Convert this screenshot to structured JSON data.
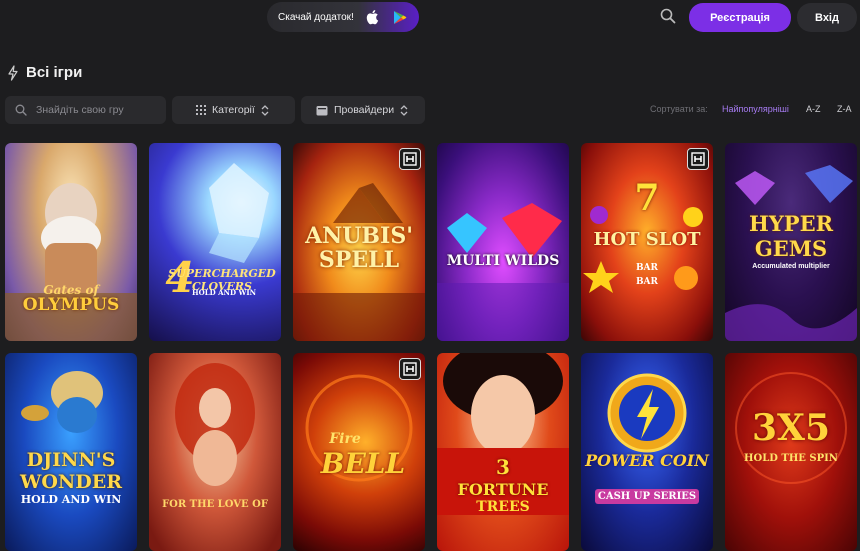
{
  "header": {
    "app_download_label": "Скачай додаток!",
    "register_label": "Реєстрація",
    "login_label": "Вхід"
  },
  "section": {
    "title": "Всі ігри"
  },
  "filters": {
    "search_placeholder": "Знайдіть свою гру",
    "categories_label": "Категорії",
    "providers_label": "Провайдери",
    "sort_label": "Сортувати за:",
    "sort_options": [
      "Найпопулярніші",
      "A-Z",
      "Z-A"
    ],
    "sort_active": "Найпопулярніші"
  },
  "games": [
    {
      "title_lines": [
        "Gates of",
        "OLYMPUS"
      ],
      "badge": false
    },
    {
      "title_lines": [
        "4",
        "SUPERCHARGED CLOVERS",
        "HOLD AND WIN"
      ],
      "badge": false
    },
    {
      "title_lines": [
        "ANUBIS'",
        "SPELL"
      ],
      "badge": true
    },
    {
      "title_lines": [
        "MULTI WILDS"
      ],
      "badge": false
    },
    {
      "title_lines": [
        "7",
        "HOT SLOT",
        "BAR",
        "BAR"
      ],
      "badge": true
    },
    {
      "title_lines": [
        "HYPER",
        "GEMS",
        "Accumulated multiplier"
      ],
      "badge": false
    },
    {
      "title_lines": [
        "DJINN'S",
        "WONDER",
        "HOLD AND WIN"
      ],
      "badge": false
    },
    {
      "title_lines": [
        "FOR THE LOVE OF"
      ],
      "badge": false
    },
    {
      "title_lines": [
        "Fire",
        "BELL"
      ],
      "badge": true
    },
    {
      "title_lines": [
        "3",
        "FORTUNE",
        "TREES"
      ],
      "badge": false
    },
    {
      "title_lines": [
        "POWER COIN",
        "CASH UP SERIES"
      ],
      "badge": false
    },
    {
      "title_lines": [
        "3X5",
        "HOLD THE SPIN"
      ],
      "badge": false
    }
  ],
  "badge_icon": "provider-logo-icon",
  "colors": {
    "accent": "#7c2fe6",
    "background": "#1d1d1f",
    "sort_active": "#a77cf3"
  }
}
